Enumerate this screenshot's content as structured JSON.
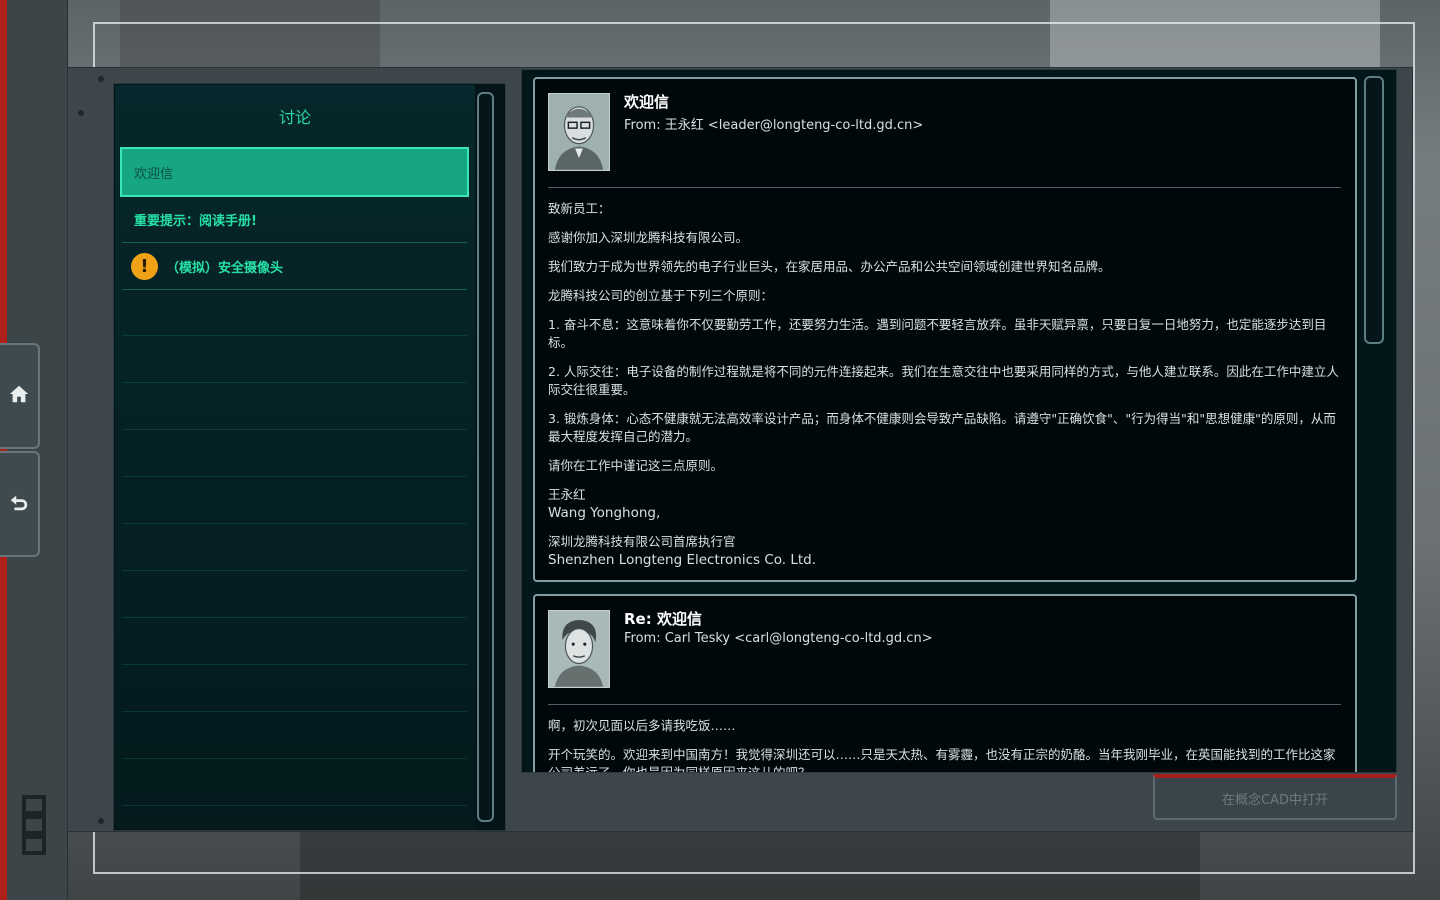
{
  "sidebar": {
    "home_icon": "home-icon",
    "back_icon": "back-icon",
    "logo_icon": "logo-icon"
  },
  "list": {
    "title": "讨论",
    "items": [
      {
        "label": "欢迎信",
        "selected": true
      },
      {
        "label": "重要提示：阅读手册!",
        "selected": false
      },
      {
        "label": "（模拟）安全摄像头",
        "selected": false,
        "icon": "warning-icon"
      }
    ],
    "empty_rows": 11
  },
  "mails": [
    {
      "subject": "欢迎信",
      "from": "From: 王永红 <leader@longteng-co-ltd.gd.cn>",
      "paragraphs": [
        "致新员工：",
        "感谢你加入深圳龙腾科技有限公司。",
        "我们致力于成为世界领先的电子行业巨头，在家居用品、办公产品和公共空间领域创建世界知名品牌。",
        "龙腾科技公司的创立基于下列三个原则：",
        "1. 奋斗不息：这意味着你不仅要勤劳工作，还要努力生活。遇到问题不要轻言放弃。虽非天赋异禀，只要日复一日地努力，也定能逐步达到目标。",
        "2. 人际交往：电子设备的制作过程就是将不同的元件连接起来。我们在生意交往中也要采用同样的方式，与他人建立联系。因此在工作中建立人际交往很重要。",
        "3. 锻炼身体：心态不健康就无法高效率设计产品；而身体不健康则会导致产品缺陷。请遵守\"正确饮食\"、\"行为得当\"和\"思想健康\"的原则，从而最大程度发挥自己的潜力。",
        "请你在工作中谨记这三点原则。"
      ],
      "signature_name_cn": "王永红",
      "signature_name_en": "Wang Yonghong,",
      "signature_title_cn": "深圳龙腾科技有限公司首席执行官",
      "signature_company_en": "Shenzhen Longteng Electronics Co. Ltd."
    },
    {
      "subject": "Re: 欢迎信",
      "from": "From: Carl Tesky <carl@longteng-co-ltd.gd.cn>",
      "paragraphs": [
        "啊，初次见面以后多请我吃饭……",
        "开个玩笑的。欢迎来到中国南方！我觉得深圳还可以……只是天太热、有雾霾，也没有正宗的奶酪。当年我刚毕业，在英国能找到的工作比这家公司差远了，你也是因为同样原因来这儿的吧？"
      ]
    }
  ],
  "actions": {
    "open_cad_label": "在概念CAD中打开"
  },
  "colors": {
    "accent": "#27d6a1",
    "selected_bg": "#16a683",
    "warning": "#f0a216",
    "alert_red": "#a41f1a"
  }
}
